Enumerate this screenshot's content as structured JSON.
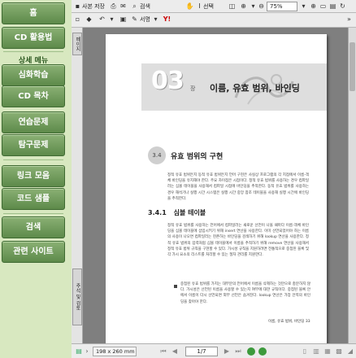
{
  "nav": {
    "items": [
      "홈",
      "CD 활용법",
      "심화학습",
      "CD 목차",
      "연습문제",
      "탐구문제",
      "링크 모음",
      "코드 샘플",
      "검색",
      "관련 사이트"
    ],
    "section_label": "상세 메뉴"
  },
  "toolbar": {
    "save_copy": "사본 저장",
    "search": "검색",
    "select": "선택",
    "zoom": "75%",
    "sign": "서명"
  },
  "sidetabs": {
    "bookmarks": "페이지",
    "comments": "주석 및 검토"
  },
  "page": {
    "chapter_number": "03",
    "chapter_suffix": "장",
    "chapter_title": "이름, 유효 범위, 바인딩",
    "section_number": "3.4",
    "section_title": "유효 범위의 구현",
    "para1": "정적 유효 범위든지 동적 유효 범위든지 언어 구현은 사실상 프로그램의 각 지점에서 이름-객체 바인딩을 유지해야 한다. 주요 차이점은 시점이다. 정적 유효 범위를 사용하는 경우 컴파일러는 심볼 테이블을 사용해서 컴파일 시점에 바인딩을 추적한다. 동적 유효 범위를 사용하는 경우 해석기나 실행 시간 시스템은 실행 시간 중앙 참조 테이블을 사용해 실행 시간에 바인딩을 추적한다.",
    "subsection_number": "3.4.1",
    "subsection_title": "심볼 테이블",
    "para2": "정적 유효 범위를 사용하는 언어에서 컴파일러는 새로운 선언이 나올 때마다 이름-객체 바인딩을 심볼 테이블에 삽입시키기 위해 insert 연산을 사용한다. 이미 선언되었어야 하는 이름의 사용이 나오면 컴파일러는 현존하는 바인딩을 검색하기 위해 lookup 연산을 사용한다. 정적 유효 범위의 입력처럼 심볼 테이블에서 이름을 추적하기 위해 remove 연산을 사용해서 정적 유효 범위 규칙을 구현할 수 있다. 가시성 규칙을 지원하려면 전통적으로 중첩된 블록 및 각 가시 요소의 리스트를 처리할 수 있는 절차 관리를 지원한다.",
    "para3": "중첩된 유효 범위를 가지는 대부분의 언어에서 이름을 삭제하는 것만으로 충분하지 않다. 가시성은 선언된 이름을 사용할 수 있는지 여부에 대한 규칙이다. 중첩된 블록 안에서 이름이 다시 선언되면 외부 선언은 숨겨진다. lookup 연산은 가장 안쪽의 바인딩을 찾아야 한다.",
    "footer": "이름, 유효 범위, 바인딩  33"
  },
  "statusbar": {
    "page_size": "198 x 260 mm",
    "page_indicator": "1/7"
  }
}
